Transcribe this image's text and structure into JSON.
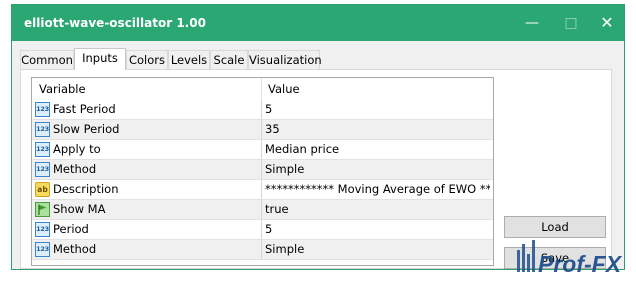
{
  "window": {
    "title": "elliott-wave-oscillator 1.00",
    "accent_color": "#2aa772"
  },
  "tabs": [
    {
      "label": "Common",
      "active": false
    },
    {
      "label": "Inputs",
      "active": true
    },
    {
      "label": "Colors",
      "active": false
    },
    {
      "label": "Levels",
      "active": false
    },
    {
      "label": "Scale",
      "active": false
    },
    {
      "label": "Visualization",
      "active": false
    }
  ],
  "grid": {
    "headers": {
      "variable": "Variable",
      "value": "Value"
    },
    "rows": [
      {
        "icon": "numeric-icon",
        "name": "Fast Period",
        "value": "5"
      },
      {
        "icon": "numeric-icon",
        "name": "Slow Period",
        "value": "35"
      },
      {
        "icon": "numeric-icon",
        "name": "Apply to",
        "value": "Median price"
      },
      {
        "icon": "numeric-icon",
        "name": "Method",
        "value": "Simple"
      },
      {
        "icon": "text-icon",
        "name": "Description",
        "value": "************ Moving Average of EWO ****"
      },
      {
        "icon": "bool-flag-icon",
        "name": "Show MA",
        "value": "true"
      },
      {
        "icon": "numeric-icon",
        "name": "Period",
        "value": "5"
      },
      {
        "icon": "numeric-icon",
        "name": "Method",
        "value": "Simple"
      }
    ]
  },
  "buttons": {
    "load": "Load",
    "save": "Save"
  },
  "watermark": {
    "text": "Prof-FX"
  }
}
